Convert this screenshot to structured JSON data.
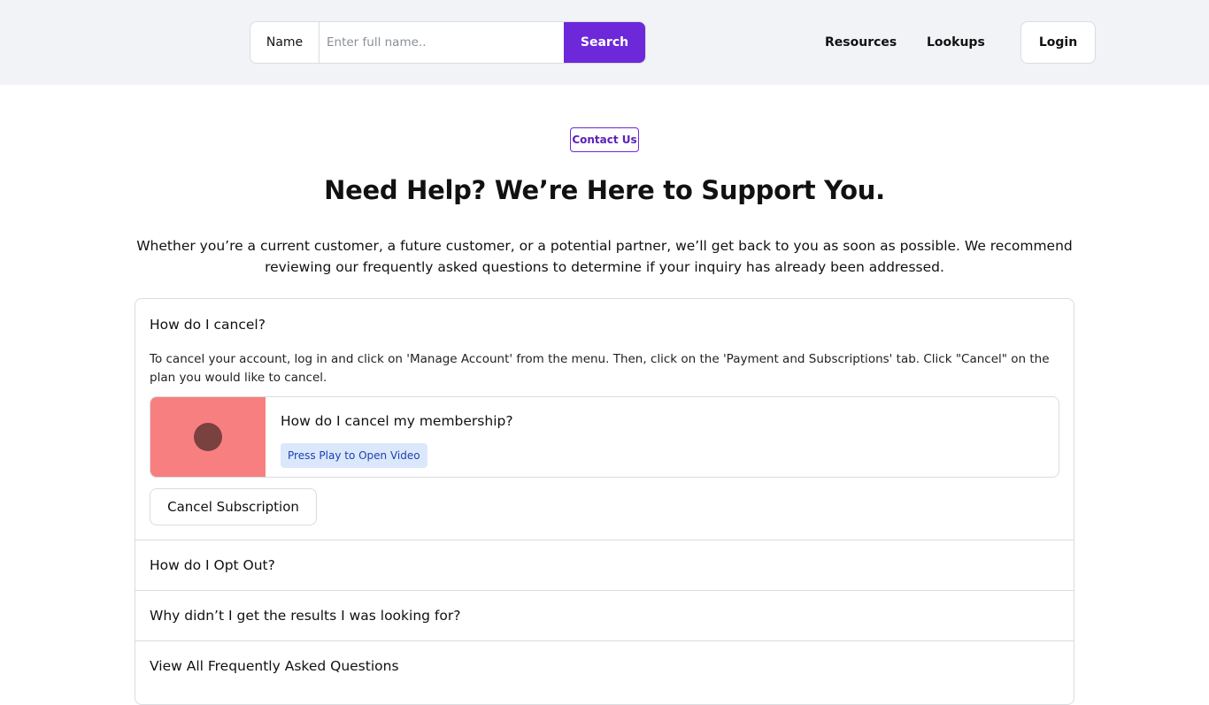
{
  "header": {
    "search": {
      "type_label": "Name",
      "placeholder": "Enter full name..",
      "button_label": "Search"
    },
    "nav": {
      "resources": "Resources",
      "lookups": "Lookups",
      "login": "Login"
    }
  },
  "main": {
    "badge": "Contact Us",
    "title": "Need Help? We’re Here to Support You.",
    "intro": "Whether you’re a current customer, a future customer, or a potential partner, we’ll get back to you as soon as possible. We recommend reviewing our frequently asked questions to determine if your inquiry has already been addressed.",
    "faq": {
      "expanded": {
        "question": "How do I cancel?",
        "answer": "To cancel your account, log in and click on 'Manage Account' from the menu. Then, click on the 'Payment and Subscriptions' tab. Click \"Cancel\" on the plan you would like to cancel.",
        "video": {
          "title": "How do I cancel my membership?",
          "badge": "Press Play to Open Video",
          "thumb_color": "#f87f7f"
        },
        "action_label": "Cancel Subscription"
      },
      "items": [
        {
          "question": "How do I Opt Out?"
        },
        {
          "question": "Why didn’t I get the results I was looking for?"
        },
        {
          "question": "View All Frequently Asked Questions"
        }
      ]
    }
  },
  "colors": {
    "accent": "#6d28d9",
    "topbar_bg": "#f1f3f6",
    "badge_bg": "#dbe8fb"
  }
}
